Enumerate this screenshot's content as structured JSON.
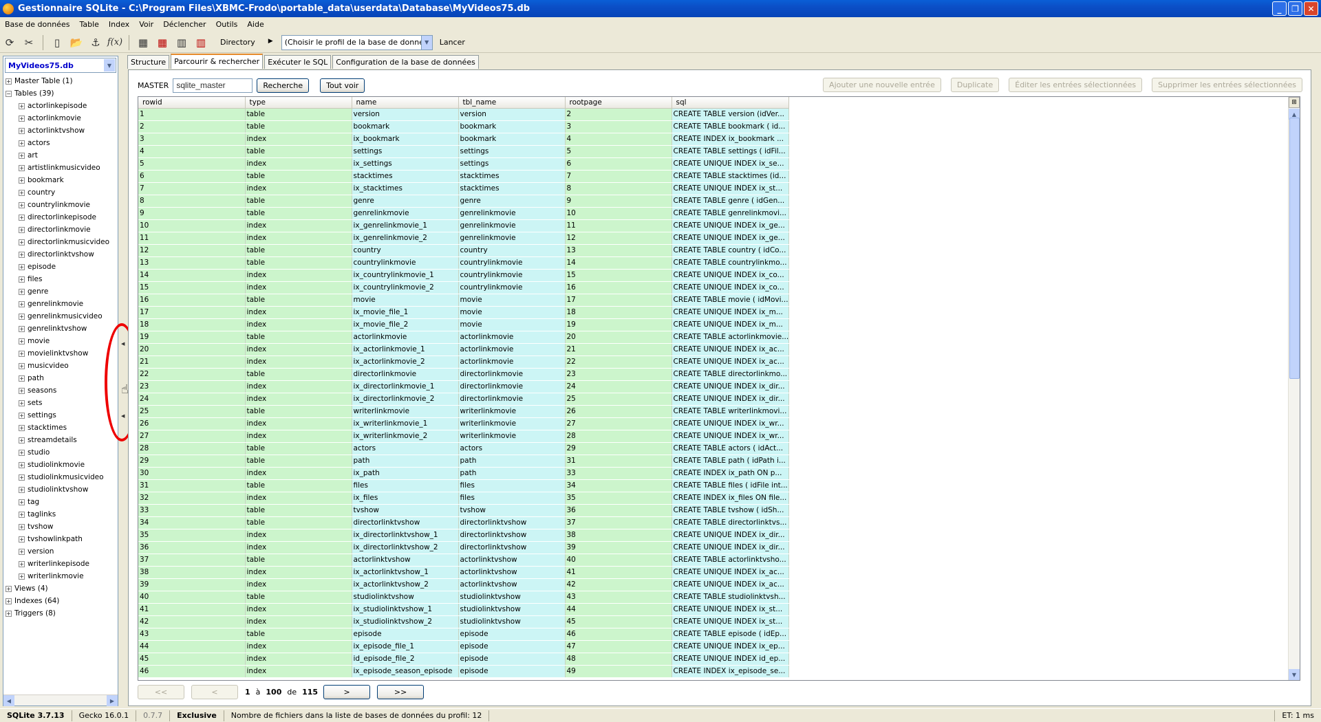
{
  "window": {
    "title": "Gestionnaire SQLite - C:\\Program Files\\XBMC-Frodo\\portable_data\\userdata\\Database\\MyVideos75.db"
  },
  "menu": [
    "Base de données",
    "Table",
    "Index",
    "Voir",
    "Déclencher",
    "Outils",
    "Aide"
  ],
  "toolbar": {
    "directory_label": "Directory",
    "profile_placeholder": "(Choisir le profil de la base de données)",
    "launch_label": "Lancer"
  },
  "left": {
    "db_name": "MyVideos75.db",
    "master_table": "Master Table (1)",
    "tables_label": "Tables (39)",
    "tables": [
      "actorlinkepisode",
      "actorlinkmovie",
      "actorlinktvshow",
      "actors",
      "art",
      "artistlinkmusicvideo",
      "bookmark",
      "country",
      "countrylinkmovie",
      "directorlinkepisode",
      "directorlinkmovie",
      "directorlinkmusicvideo",
      "directorlinktvshow",
      "episode",
      "files",
      "genre",
      "genrelinkmovie",
      "genrelinkmusicvideo",
      "genrelinktvshow",
      "movie",
      "movielinktvshow",
      "musicvideo",
      "path",
      "seasons",
      "sets",
      "settings",
      "stacktimes",
      "streamdetails",
      "studio",
      "studiolinkmovie",
      "studiolinkmusicvideo",
      "studiolinktvshow",
      "tag",
      "taglinks",
      "tvshow",
      "tvshowlinkpath",
      "version",
      "writerlinkepisode",
      "writerlinkmovie"
    ],
    "views_label": "Views (4)",
    "indexes_label": "Indexes (64)",
    "triggers_label": "Triggers (8)"
  },
  "tabs": [
    "Structure",
    "Parcourir & rechercher",
    "Exécuter le SQL",
    "Configuration de la base de données"
  ],
  "browse": {
    "master_label": "MASTER",
    "search_value": "sqlite_master",
    "search_btn": "Recherche",
    "show_all_btn": "Tout voir",
    "add_btn": "Ajouter une nouvelle entrée",
    "duplicate_btn": "Duplicate",
    "edit_btn": "Éditer les entrées sélectionnées",
    "delete_btn": "Supprimer les entrées sélectionnées",
    "columns": [
      "rowid",
      "type",
      "name",
      "tbl_name",
      "rootpage",
      "sql"
    ],
    "rows": [
      [
        "1",
        "table",
        "version",
        "version",
        "2",
        "CREATE TABLE version (idVer..."
      ],
      [
        "2",
        "table",
        "bookmark",
        "bookmark",
        "3",
        "CREATE TABLE bookmark ( id..."
      ],
      [
        "3",
        "index",
        "ix_bookmark",
        "bookmark",
        "4",
        "CREATE INDEX ix_bookmark ..."
      ],
      [
        "4",
        "table",
        "settings",
        "settings",
        "5",
        "CREATE TABLE settings ( idFil..."
      ],
      [
        "5",
        "index",
        "ix_settings",
        "settings",
        "6",
        "CREATE UNIQUE INDEX ix_se..."
      ],
      [
        "6",
        "table",
        "stacktimes",
        "stacktimes",
        "7",
        "CREATE TABLE stacktimes (id..."
      ],
      [
        "7",
        "index",
        "ix_stacktimes",
        "stacktimes",
        "8",
        "CREATE UNIQUE INDEX ix_st..."
      ],
      [
        "8",
        "table",
        "genre",
        "genre",
        "9",
        "CREATE TABLE genre ( idGen..."
      ],
      [
        "9",
        "table",
        "genrelinkmovie",
        "genrelinkmovie",
        "10",
        "CREATE TABLE genrelinkmovi..."
      ],
      [
        "10",
        "index",
        "ix_genrelinkmovie_1",
        "genrelinkmovie",
        "11",
        "CREATE UNIQUE INDEX ix_ge..."
      ],
      [
        "11",
        "index",
        "ix_genrelinkmovie_2",
        "genrelinkmovie",
        "12",
        "CREATE UNIQUE INDEX ix_ge..."
      ],
      [
        "12",
        "table",
        "country",
        "country",
        "13",
        "CREATE TABLE country ( idCo..."
      ],
      [
        "13",
        "table",
        "countrylinkmovie",
        "countrylinkmovie",
        "14",
        "CREATE TABLE countrylinkmo..."
      ],
      [
        "14",
        "index",
        "ix_countrylinkmovie_1",
        "countrylinkmovie",
        "15",
        "CREATE UNIQUE INDEX ix_co..."
      ],
      [
        "15",
        "index",
        "ix_countrylinkmovie_2",
        "countrylinkmovie",
        "16",
        "CREATE UNIQUE INDEX ix_co..."
      ],
      [
        "16",
        "table",
        "movie",
        "movie",
        "17",
        "CREATE TABLE movie ( idMovi..."
      ],
      [
        "17",
        "index",
        "ix_movie_file_1",
        "movie",
        "18",
        "CREATE UNIQUE INDEX ix_m..."
      ],
      [
        "18",
        "index",
        "ix_movie_file_2",
        "movie",
        "19",
        "CREATE UNIQUE INDEX ix_m..."
      ],
      [
        "19",
        "table",
        "actorlinkmovie",
        "actorlinkmovie",
        "20",
        "CREATE TABLE actorlinkmovie..."
      ],
      [
        "20",
        "index",
        "ix_actorlinkmovie_1",
        "actorlinkmovie",
        "21",
        "CREATE UNIQUE INDEX ix_ac..."
      ],
      [
        "21",
        "index",
        "ix_actorlinkmovie_2",
        "actorlinkmovie",
        "22",
        "CREATE UNIQUE INDEX ix_ac..."
      ],
      [
        "22",
        "table",
        "directorlinkmovie",
        "directorlinkmovie",
        "23",
        "CREATE TABLE directorlinkmo..."
      ],
      [
        "23",
        "index",
        "ix_directorlinkmovie_1",
        "directorlinkmovie",
        "24",
        "CREATE UNIQUE INDEX ix_dir..."
      ],
      [
        "24",
        "index",
        "ix_directorlinkmovie_2",
        "directorlinkmovie",
        "25",
        "CREATE UNIQUE INDEX ix_dir..."
      ],
      [
        "25",
        "table",
        "writerlinkmovie",
        "writerlinkmovie",
        "26",
        "CREATE TABLE writerlinkmovi..."
      ],
      [
        "26",
        "index",
        "ix_writerlinkmovie_1",
        "writerlinkmovie",
        "27",
        "CREATE UNIQUE INDEX ix_wr..."
      ],
      [
        "27",
        "index",
        "ix_writerlinkmovie_2",
        "writerlinkmovie",
        "28",
        "CREATE UNIQUE INDEX ix_wr..."
      ],
      [
        "28",
        "table",
        "actors",
        "actors",
        "29",
        "CREATE TABLE actors ( idAct..."
      ],
      [
        "29",
        "table",
        "path",
        "path",
        "31",
        "CREATE TABLE path ( idPath i..."
      ],
      [
        "30",
        "index",
        "ix_path",
        "path",
        "33",
        "CREATE INDEX ix_path ON p..."
      ],
      [
        "31",
        "table",
        "files",
        "files",
        "34",
        "CREATE TABLE files ( idFile int..."
      ],
      [
        "32",
        "index",
        "ix_files",
        "files",
        "35",
        "CREATE INDEX ix_files ON file..."
      ],
      [
        "33",
        "table",
        "tvshow",
        "tvshow",
        "36",
        "CREATE TABLE tvshow ( idSh..."
      ],
      [
        "34",
        "table",
        "directorlinktvshow",
        "directorlinktvshow",
        "37",
        "CREATE TABLE directorlinktvs..."
      ],
      [
        "35",
        "index",
        "ix_directorlinktvshow_1",
        "directorlinktvshow",
        "38",
        "CREATE UNIQUE INDEX ix_dir..."
      ],
      [
        "36",
        "index",
        "ix_directorlinktvshow_2",
        "directorlinktvshow",
        "39",
        "CREATE UNIQUE INDEX ix_dir..."
      ],
      [
        "37",
        "table",
        "actorlinktvshow",
        "actorlinktvshow",
        "40",
        "CREATE TABLE actorlinktvsho..."
      ],
      [
        "38",
        "index",
        "ix_actorlinktvshow_1",
        "actorlinktvshow",
        "41",
        "CREATE UNIQUE INDEX ix_ac..."
      ],
      [
        "39",
        "index",
        "ix_actorlinktvshow_2",
        "actorlinktvshow",
        "42",
        "CREATE UNIQUE INDEX ix_ac..."
      ],
      [
        "40",
        "table",
        "studiolinktvshow",
        "studiolinktvshow",
        "43",
        "CREATE TABLE studiolinktvsh..."
      ],
      [
        "41",
        "index",
        "ix_studiolinktvshow_1",
        "studiolinktvshow",
        "44",
        "CREATE UNIQUE INDEX ix_st..."
      ],
      [
        "42",
        "index",
        "ix_studiolinktvshow_2",
        "studiolinktvshow",
        "45",
        "CREATE UNIQUE INDEX ix_st..."
      ],
      [
        "43",
        "table",
        "episode",
        "episode",
        "46",
        "CREATE TABLE episode ( idEp..."
      ],
      [
        "44",
        "index",
        "ix_episode_file_1",
        "episode",
        "47",
        "CREATE UNIQUE INDEX ix_ep..."
      ],
      [
        "45",
        "index",
        "id_episode_file_2",
        "episode",
        "48",
        "CREATE UNIQUE INDEX id_ep..."
      ],
      [
        "46",
        "index",
        "ix_episode_season_episode",
        "episode",
        "49",
        "CREATE INDEX ix_episode_se..."
      ]
    ]
  },
  "pager": {
    "first": "<<",
    "prev": "<",
    "from": "1",
    "to_word": "à",
    "to": "100",
    "of_word": "de",
    "total": "115",
    "next": ">",
    "last": ">>"
  },
  "status": {
    "sqlite": "SQLite 3.7.13",
    "gecko": "Gecko 16.0.1",
    "version": "0.7.7",
    "mode": "Exclusive",
    "message": "Nombre de fichiers dans la liste de bases de données du profil: 12",
    "et": "ET: 1 ms"
  }
}
